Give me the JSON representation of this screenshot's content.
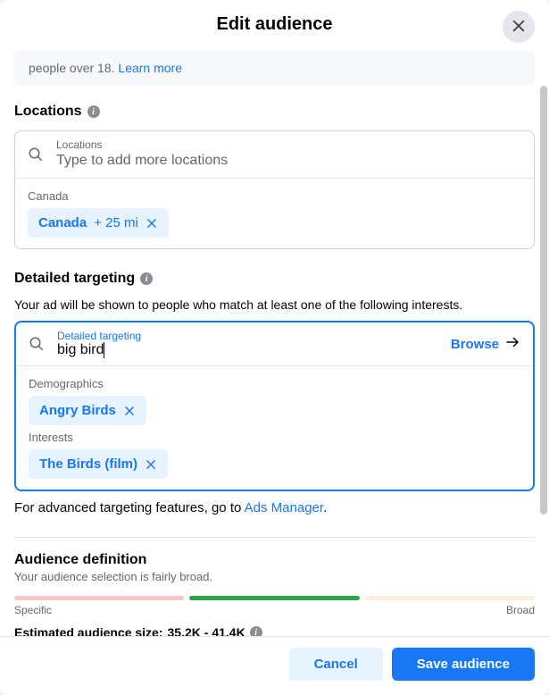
{
  "header": {
    "title": "Edit audience"
  },
  "banner": {
    "prefix": "people over 18. ",
    "link": "Learn more"
  },
  "locations": {
    "label": "Locations",
    "field_label": "Locations",
    "placeholder": "Type to add more locations",
    "groups": [
      {
        "name": "Canada",
        "chips": [
          {
            "label": "Canada",
            "suffix": "+ 25 mi"
          }
        ]
      }
    ]
  },
  "detailed": {
    "label": "Detailed targeting",
    "sublabel": "Your ad will be shown to people who match at least one of the following interests.",
    "field_label": "Detailed targeting",
    "value": "big bird",
    "browse": "Browse",
    "groups": [
      {
        "name": "Demographics",
        "chips": [
          {
            "label": "Angry Birds"
          }
        ]
      },
      {
        "name": "Interests",
        "chips": [
          {
            "label": "The Birds (film)"
          }
        ]
      }
    ],
    "advanced_prefix": "For advanced targeting features, go to ",
    "advanced_link": "Ads Manager",
    "advanced_suffix": "."
  },
  "audience": {
    "title": "Audience definition",
    "subtitle": "Your audience selection is fairly broad.",
    "specific_label": "Specific",
    "broad_label": "Broad",
    "est_label": "Estimated audience size: ",
    "est_value": "35.2K - 41.4K"
  },
  "footer": {
    "cancel": "Cancel",
    "save": "Save audience"
  }
}
